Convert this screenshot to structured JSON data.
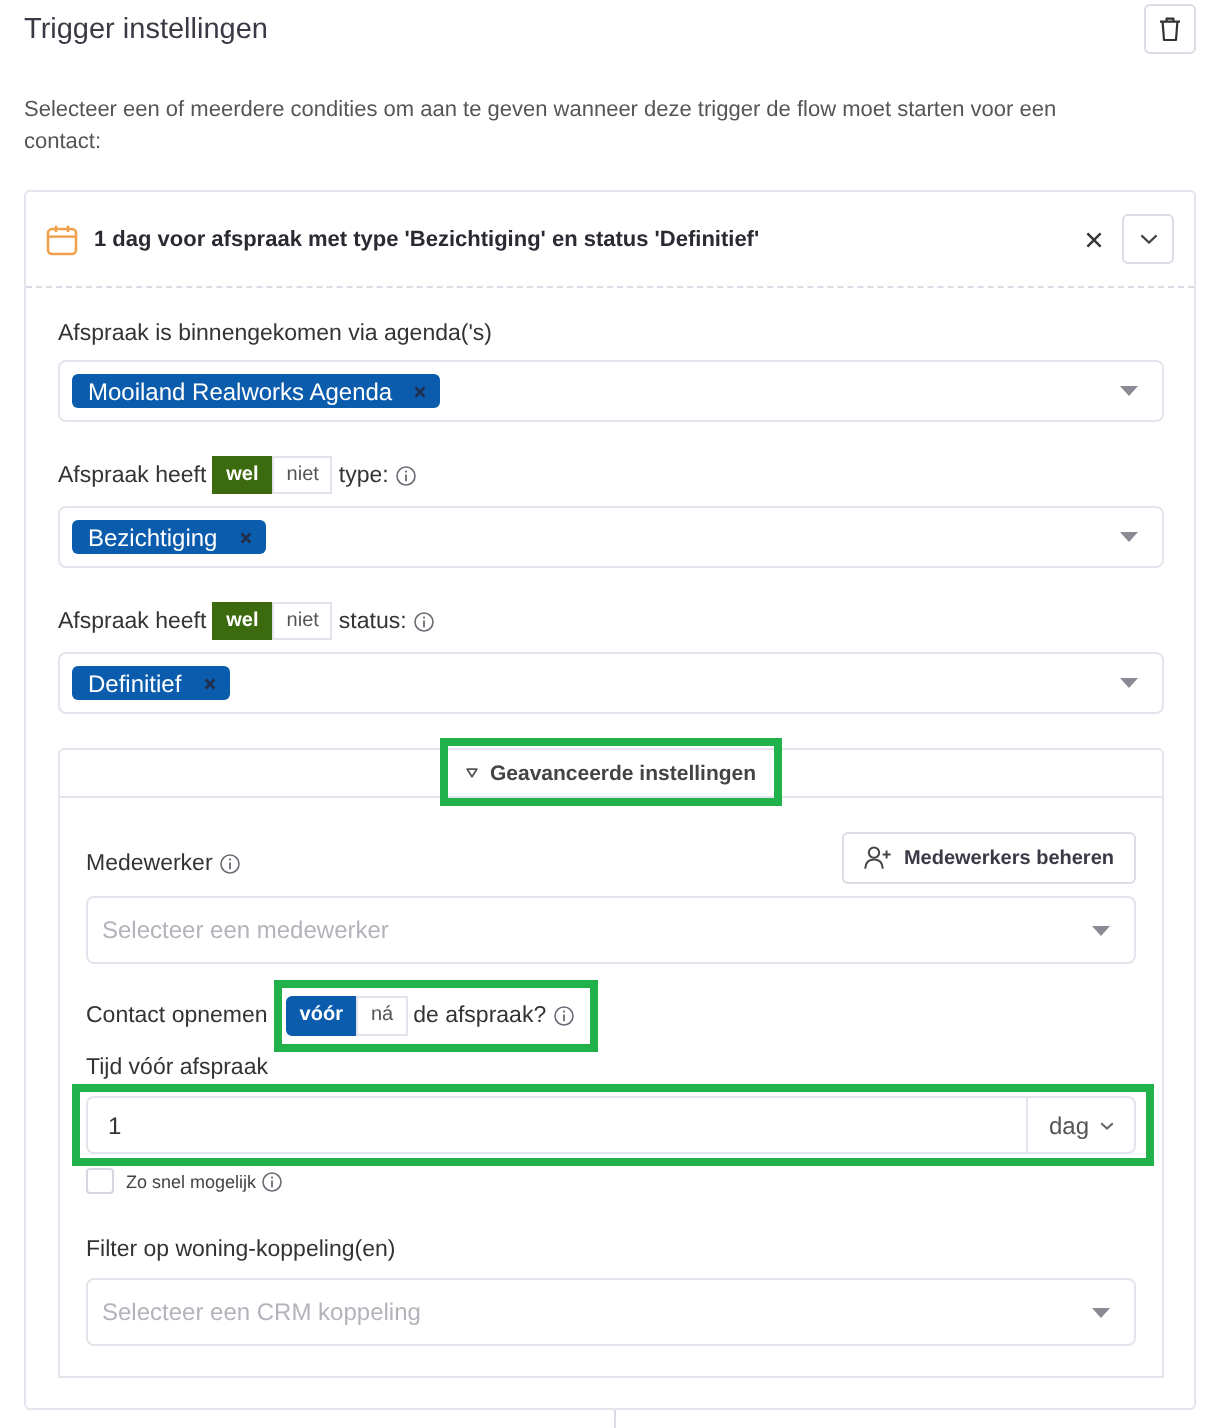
{
  "panel": {
    "title": "Trigger instellingen",
    "description": "Selecteer een of meerdere condities om aan te geven wanneer deze trigger de flow moet starten voor een contact:"
  },
  "condition": {
    "summary": "1 dag voor afspraak met type 'Bezichtiging' en status 'Definitief'",
    "expanded": true,
    "fields": [
      {
        "kind": "plain",
        "label": "Afspraak is binnengekomen via agenda('s)",
        "chips": [
          "Mooiland Realworks Agenda"
        ]
      },
      {
        "kind": "toggle",
        "label": "Afspraak heeft",
        "options": [
          {
            "label": "wel",
            "selected": true
          },
          {
            "label": "niet",
            "selected": false
          }
        ],
        "suffix": "type:",
        "chips": [
          "Bezichtiging"
        ]
      },
      {
        "kind": "toggle",
        "label": "Afspraak heeft",
        "options": [
          {
            "label": "wel",
            "selected": true
          },
          {
            "label": "niet",
            "selected": false
          }
        ],
        "suffix": "status:",
        "chips": [
          "Definitief"
        ]
      }
    ],
    "advanced": {
      "title": "Geavanceerde instellingen",
      "expanded": true,
      "highlighted": true,
      "employee": {
        "label": "Medewerker",
        "button": "Medewerkers beheren",
        "placeholder": "Selecteer een medewerker"
      },
      "timing": {
        "label": "Contact opnemen",
        "options": [
          {
            "label": "vóór",
            "selected": true
          },
          {
            "label": "ná",
            "selected": false
          }
        ],
        "suffix": "de afspraak?",
        "highlighted": true
      },
      "delay": {
        "label": "Tijd vóór afspraak",
        "value": "1",
        "unit": "dag",
        "highlighted": true
      },
      "asap": {
        "label": "Zo snel mogelijk",
        "checked": false
      },
      "crm": {
        "label": "Filter op woning-koppeling(en)",
        "placeholder": "Selecteer een CRM koppeling"
      }
    }
  }
}
